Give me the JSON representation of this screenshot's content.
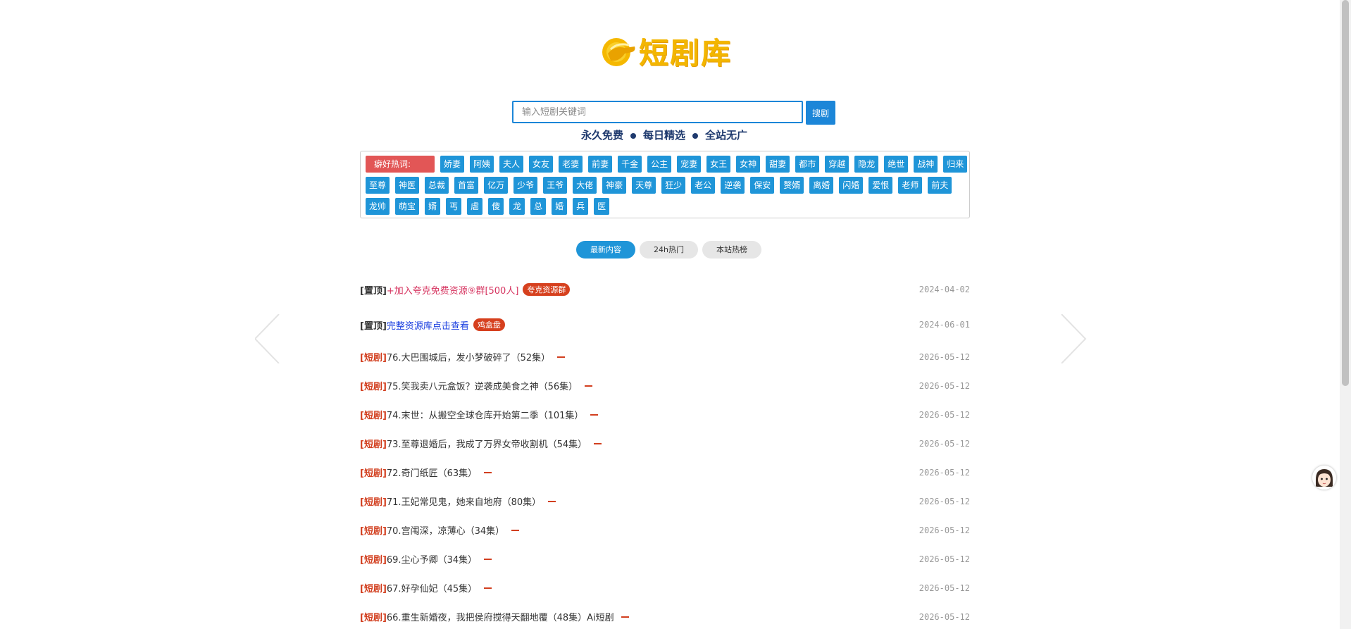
{
  "logo": {
    "text": "短剧库"
  },
  "search": {
    "placeholder": "输入短剧关键词",
    "button": "搜剧"
  },
  "slogan": [
    "永久免费",
    "每日精选",
    "全站无广"
  ],
  "tags": {
    "label": "癖好热词:",
    "items": [
      "娇妻",
      "阿姨",
      "夫人",
      "女友",
      "老婆",
      "前妻",
      "千金",
      "公主",
      "宠妻",
      "女王",
      "女神",
      "甜妻",
      "都市",
      "穿越",
      "隐龙",
      "绝世",
      "战神",
      "归来",
      "至尊",
      "神医",
      "总裁",
      "首富",
      "亿万",
      "少爷",
      "王爷",
      "大佬",
      "神豪",
      "天尊",
      "狂少",
      "老公",
      "逆袭",
      "保安",
      "赘婿",
      "离婚",
      "闪婚",
      "爱恨",
      "老师",
      "前夫",
      "龙帅",
      "萌宝",
      "婿",
      "丐",
      "虐",
      "傻",
      "龙",
      "总",
      "婚",
      "兵",
      "医"
    ]
  },
  "tabs": [
    "最新内容",
    "24h热门",
    "本站热榜"
  ],
  "pinned": [
    {
      "prefix": "[置顶]",
      "title": "+加入夸克免费资源⑨群[500人]",
      "badge": "夸克资源群",
      "date": "2024-04-02"
    },
    {
      "prefix": "[置顶]",
      "title": "完整资源库点击查看",
      "badge": "鸡盒盘",
      "date": "2024-06-01"
    }
  ],
  "items": [
    {
      "prefix": "[短剧]",
      "title": "76.大巴围城后，发小梦破碎了（52集）",
      "date": "2026-05-12"
    },
    {
      "prefix": "[短剧]",
      "title": "75.笑我卖八元盒饭？逆袭成美食之神（56集）",
      "date": "2026-05-12"
    },
    {
      "prefix": "[短剧]",
      "title": "74.末世：从搬空全球仓库开始第二季（101集）",
      "date": "2026-05-12"
    },
    {
      "prefix": "[短剧]",
      "title": "73.至尊退婚后，我成了万界女帝收割机（54集）",
      "date": "2026-05-12"
    },
    {
      "prefix": "[短剧]",
      "title": "72.奇门纸匠（63集）",
      "date": "2026-05-12"
    },
    {
      "prefix": "[短剧]",
      "title": "71.王妃常见鬼，她来自地府（80集）",
      "date": "2026-05-12"
    },
    {
      "prefix": "[短剧]",
      "title": "70.宫闱深，凉薄心（34集）",
      "date": "2026-05-12"
    },
    {
      "prefix": "[短剧]",
      "title": "69.尘心予卿（34集）",
      "date": "2026-05-12"
    },
    {
      "prefix": "[短剧]",
      "title": "67.好孕仙妃（45集）",
      "date": "2026-05-12"
    },
    {
      "prefix": "[短剧]",
      "title": "66.重生新婚夜，我把侯府搅得天翻地覆（48集）Ai短剧",
      "date": "2026-05-12"
    }
  ],
  "colors": {
    "accent": "#1f95d8",
    "label": "#e25656",
    "prefix": "#d23f1f",
    "logo": "#f3b600"
  },
  "icons": {
    "logo": "hand-coin-icon",
    "left": "chevron-left-icon",
    "right": "chevron-right-icon",
    "avatar": "avatar-icon"
  }
}
